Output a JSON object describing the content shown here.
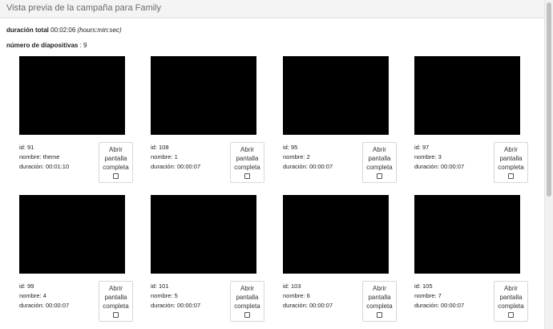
{
  "header": {
    "title": "Vista previa de la campaña para Family"
  },
  "summary": {
    "duration_label": "duración total",
    "duration_value": "00:02:06",
    "duration_unit": "(hours:min:sec)",
    "slides_label": "número de diapositivas",
    "slides_sep": " : ",
    "slides_value": "9"
  },
  "labels": {
    "id": "id: ",
    "name": "nombre: ",
    "duration": "duración: ",
    "open_line1": "Abrir",
    "open_line2": "pantalla",
    "open_line3": "completa",
    "open_icon": "fullscreen-icon"
  },
  "slides": [
    {
      "id": "91",
      "nombre": "theme",
      "duracion": "00:01:10"
    },
    {
      "id": "108",
      "nombre": "1",
      "duracion": "00:00:07"
    },
    {
      "id": "95",
      "nombre": "2",
      "duracion": "00:00:07"
    },
    {
      "id": "97",
      "nombre": "3",
      "duracion": "00:00:07"
    },
    {
      "id": "99",
      "nombre": "4",
      "duracion": "00:00:07"
    },
    {
      "id": "101",
      "nombre": "5",
      "duracion": "00:00:07"
    },
    {
      "id": "103",
      "nombre": "6",
      "duracion": "00:00:07"
    },
    {
      "id": "105",
      "nombre": "7",
      "duracion": "00:00:07"
    }
  ]
}
